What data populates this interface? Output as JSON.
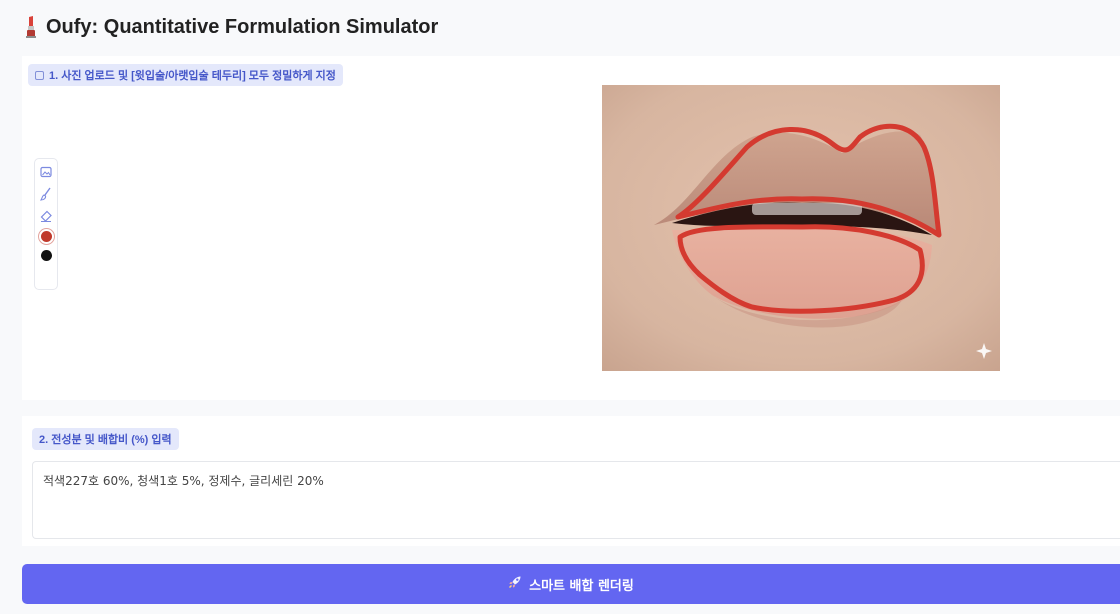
{
  "app": {
    "icon": "lipstick-icon",
    "title": "Oufy: Quantitative Formulation Simulator"
  },
  "upload_section": {
    "label": "1. 사진 업로드 및 [윗입술/아랫입술 테두리] 모두 정밀하게 지정",
    "tools": [
      "image-icon",
      "brush-icon",
      "eraser-icon"
    ],
    "colors": {
      "selected": "#c0392b",
      "secondary": "#111111"
    }
  },
  "ingredients_section": {
    "label": "2. 전성분 및 배합비 (%) 입력",
    "value": "적색227호 60%, 청색1호 5%, 정제수, 글리세린 20%"
  },
  "render_button": {
    "icon": "rocket-icon",
    "label": "스마트 배합 렌더링"
  },
  "colors": {
    "accent": "#6366f1",
    "label_bg": "#e4e8fb",
    "label_text": "#4557c9",
    "outline": "#d43a30"
  }
}
